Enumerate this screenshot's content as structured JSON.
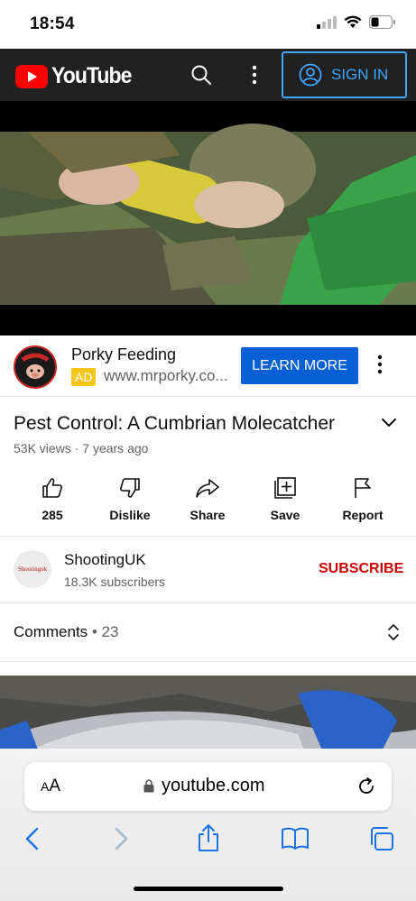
{
  "status_bar": {
    "time": "18:54",
    "icons": [
      "signal-icon",
      "wifi-icon",
      "battery-icon"
    ]
  },
  "header": {
    "brand": "YouTube",
    "signin_label": "SIGN IN",
    "accent": "#3ea6ff",
    "bg": "#212121"
  },
  "ad": {
    "title": "Porky Feeding",
    "badge": "AD",
    "url": "www.mrporky.co...",
    "cta_label": "LEARN MORE",
    "cta_color": "#065fd4",
    "badge_color": "#f5c518"
  },
  "video": {
    "title": "Pest Control: A Cumbrian Molecatcher",
    "views": "53K views",
    "age": "7 years ago",
    "separator": " · "
  },
  "actions": [
    {
      "name": "like",
      "label": "285",
      "icon": "thumbs-up-icon"
    },
    {
      "name": "dislike",
      "label": "Dislike",
      "icon": "thumbs-down-icon"
    },
    {
      "name": "share",
      "label": "Share",
      "icon": "share-icon"
    },
    {
      "name": "save",
      "label": "Save",
      "icon": "add-to-playlist-icon"
    },
    {
      "name": "report",
      "label": "Report",
      "icon": "flag-icon"
    }
  ],
  "channel": {
    "name": "ShootingUK",
    "subscribers": "18.3K subscribers",
    "avatar_text": "Shootinguk",
    "subscribe_label": "SUBSCRIBE",
    "subscribe_color": "#cc0000"
  },
  "comments": {
    "label": "Comments",
    "separator": " • ",
    "count": "23"
  },
  "browser": {
    "aa_label_small": "A",
    "aa_label_large": "A",
    "url": "youtube.com",
    "toolbar": [
      "back-icon",
      "forward-icon",
      "share-icon",
      "bookmarks-icon",
      "tabs-icon"
    ]
  }
}
